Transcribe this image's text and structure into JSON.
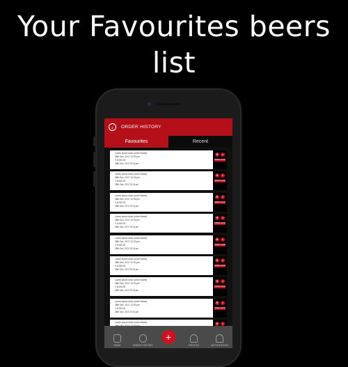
{
  "headline": {
    "line1": "Your Favourites beers",
    "line2": "list"
  },
  "appbar": {
    "back_icon": "‹",
    "title": "ORDER HISTORY"
  },
  "tabs": [
    {
      "label": "Favourites",
      "active": true
    },
    {
      "label": "Recent",
      "active": false
    }
  ],
  "orders": [
    {
      "name": "Lorem ipsum dolor (order Name)",
      "date": "28th Dec, 2017 12:00 pm",
      "price": "₹ 8,000.00",
      "time": "28th Dec, 2017 8:15 pm",
      "btn": "ORDER AGAIN"
    },
    {
      "name": "Lorem ipsum dolor (order Name)",
      "date": "28th Dec, 2017 12:00 pm",
      "price": "₹ 8,000.00",
      "time": "28th Dec, 2017 8:15 pm",
      "btn": "ORDER AGAIN"
    },
    {
      "name": "Lorem ipsum dolor (order Name)",
      "date": "28th Dec, 2017 12:00 pm",
      "price": "₹ 8,000.00",
      "time": "28th Dec, 2017 8:15 pm",
      "btn": "ORDER AGAIN"
    },
    {
      "name": "Lorem ipsum dolor (order Name)",
      "date": "28th Dec, 2017 12:00 pm",
      "price": "₹ 8,000.00",
      "time": "28th Dec, 2017 8:15 pm",
      "btn": "ORDER AGAIN"
    },
    {
      "name": "Lorem ipsum dolor (order Name)",
      "date": "28th Dec, 2017 12:00 pm",
      "price": "₹ 8,000.00",
      "time": "28th Dec, 2017 8:15 pm",
      "btn": "ORDER AGAIN"
    },
    {
      "name": "Lorem ipsum dolor (order Name)",
      "date": "28th Dec, 2017 12:00 pm",
      "price": "₹ 8,000.00",
      "time": "28th Dec, 2017 8:15 pm",
      "btn": "ORDER AGAIN"
    },
    {
      "name": "Lorem ipsum dolor (order Name)",
      "date": "28th Dec, 2017 12:00 pm",
      "price": "₹ 8,000.00",
      "time": "28th Dec, 2017 8:15 pm",
      "btn": "ORDER AGAIN"
    },
    {
      "name": "Lorem ipsum dolor (order Name)",
      "date": "28th Dec, 2017 12:00 pm",
      "price": "₹ 8,000.00",
      "time": "28th Dec, 2017 8:15 pm",
      "btn": "ORDER AGAIN"
    },
    {
      "name": "Lorem ipsum dolor (order Name)",
      "date": "28th Dec, 2017 12:00 pm",
      "price": "₹ 8,000.00",
      "time": "28th Dec, 2017 8:15 pm",
      "btn": "ORDER AGAIN"
    }
  ],
  "nav": [
    {
      "label": "HOME",
      "icon": "home-icon"
    },
    {
      "label": "ORDER HISTORY",
      "icon": "clock-icon"
    },
    {
      "label": "",
      "icon": "plus-icon"
    },
    {
      "label": "PROFILE",
      "icon": "person-icon"
    },
    {
      "label": "NOTIFICATION",
      "icon": "bell-icon"
    }
  ],
  "colors": {
    "accent": "#b5101a",
    "background": "#000000",
    "bottombar": "#4a4a4a"
  }
}
